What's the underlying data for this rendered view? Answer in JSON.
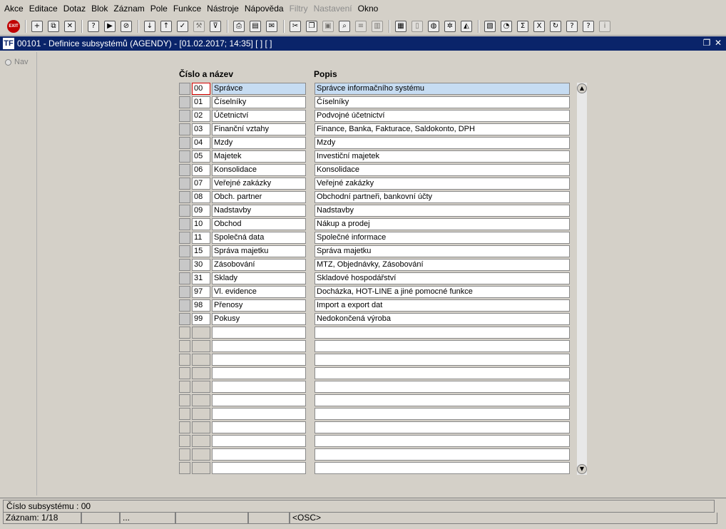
{
  "menu": [
    {
      "label": "Akce",
      "disabled": false
    },
    {
      "label": "Editace",
      "disabled": false
    },
    {
      "label": "Dotaz",
      "disabled": false
    },
    {
      "label": "Blok",
      "disabled": false
    },
    {
      "label": "Záznam",
      "disabled": false
    },
    {
      "label": "Pole",
      "disabled": false
    },
    {
      "label": "Funkce",
      "disabled": false
    },
    {
      "label": "Nástroje",
      "disabled": false
    },
    {
      "label": "Nápověda",
      "disabled": false
    },
    {
      "label": "Filtry",
      "disabled": true
    },
    {
      "label": "Nastavení",
      "disabled": true
    },
    {
      "label": "Okno",
      "disabled": false
    }
  ],
  "toolbar": {
    "exit_label": "EXIT",
    "groups": [
      [
        "insert-record-icon",
        "duplicate-record-icon",
        "delete-record-icon"
      ],
      [
        "query-enter-icon",
        "query-execute-icon",
        "query-cancel-icon"
      ],
      [
        "sort-ascending-icon",
        "sort-descending-icon",
        "checkmark-icon",
        "wrench-icon",
        "filter-icon"
      ],
      [
        "print-icon",
        "print-preview-icon",
        "send-mail-icon"
      ],
      [
        "cut-icon",
        "copy-icon",
        "paste-icon",
        "find-icon",
        "list-icon",
        "columns-icon"
      ],
      [
        "clipboard-icon",
        "save-icon",
        "globe-icon",
        "settings-wheel-icon",
        "chart-icon"
      ],
      [
        "report-icon",
        "timer-icon",
        "sum-icon",
        "excel-icon",
        "refresh-icon",
        "help-icon",
        "context-help-icon",
        "info-icon"
      ]
    ]
  },
  "window": {
    "logo": "TF",
    "title": "00101 - Definice subsystémů (AGENDY) - [01.02.2017; 14:35]  [ ] [ ]"
  },
  "nav": {
    "label": "Nav"
  },
  "columns": {
    "number_name": "Číslo a název",
    "description": "Popis"
  },
  "records": [
    {
      "num": "00",
      "name": "Správce",
      "desc": "Správce informačního systému"
    },
    {
      "num": "01",
      "name": "Číselníky",
      "desc": "Číselníky"
    },
    {
      "num": "02",
      "name": "Účetnictví",
      "desc": "Podvojné účetnictví"
    },
    {
      "num": "03",
      "name": "Finanční vztahy",
      "desc": "Finance, Banka, Fakturace, Saldokonto, DPH"
    },
    {
      "num": "04",
      "name": "Mzdy",
      "desc": "Mzdy"
    },
    {
      "num": "05",
      "name": "Majetek",
      "desc": "Investiční majetek"
    },
    {
      "num": "06",
      "name": "Konsolidace",
      "desc": "Konsolidace"
    },
    {
      "num": "07",
      "name": "Veřejné zakázky",
      "desc": "Veřejné zakázky"
    },
    {
      "num": "08",
      "name": "Obch. partner",
      "desc": "Obchodní partneři, bankovní účty"
    },
    {
      "num": "09",
      "name": "Nadstavby",
      "desc": "Nadstavby"
    },
    {
      "num": "10",
      "name": "Obchod",
      "desc": "Nákup a prodej"
    },
    {
      "num": "11",
      "name": "Společná data",
      "desc": "Společné informace"
    },
    {
      "num": "15",
      "name": "Správa majetku",
      "desc": "Správa majetku"
    },
    {
      "num": "30",
      "name": "Zásobování",
      "desc": "MTZ, Objednávky, Zásobování"
    },
    {
      "num": "31",
      "name": "Sklady",
      "desc": "Skladové hospodářství"
    },
    {
      "num": "97",
      "name": "Vl. evidence",
      "desc": "Docházka, HOT-LINE a jiné pomocné funkce"
    },
    {
      "num": "98",
      "name": "Přenosy",
      "desc": "Import a export dat"
    },
    {
      "num": "99",
      "name": "Pokusy",
      "desc": "Nedokončená výroba"
    },
    {
      "num": "",
      "name": "",
      "desc": ""
    },
    {
      "num": "",
      "name": "",
      "desc": ""
    },
    {
      "num": "",
      "name": "",
      "desc": ""
    },
    {
      "num": "",
      "name": "",
      "desc": ""
    },
    {
      "num": "",
      "name": "",
      "desc": ""
    },
    {
      "num": "",
      "name": "",
      "desc": ""
    },
    {
      "num": "",
      "name": "",
      "desc": ""
    },
    {
      "num": "",
      "name": "",
      "desc": ""
    },
    {
      "num": "",
      "name": "",
      "desc": ""
    },
    {
      "num": "",
      "name": "",
      "desc": ""
    },
    {
      "num": "",
      "name": "",
      "desc": ""
    }
  ],
  "status": {
    "message": "Číslo subsystému : 00",
    "record": "Záznam: 1/18",
    "ellipsis": "...",
    "mode": "<OSC>"
  }
}
